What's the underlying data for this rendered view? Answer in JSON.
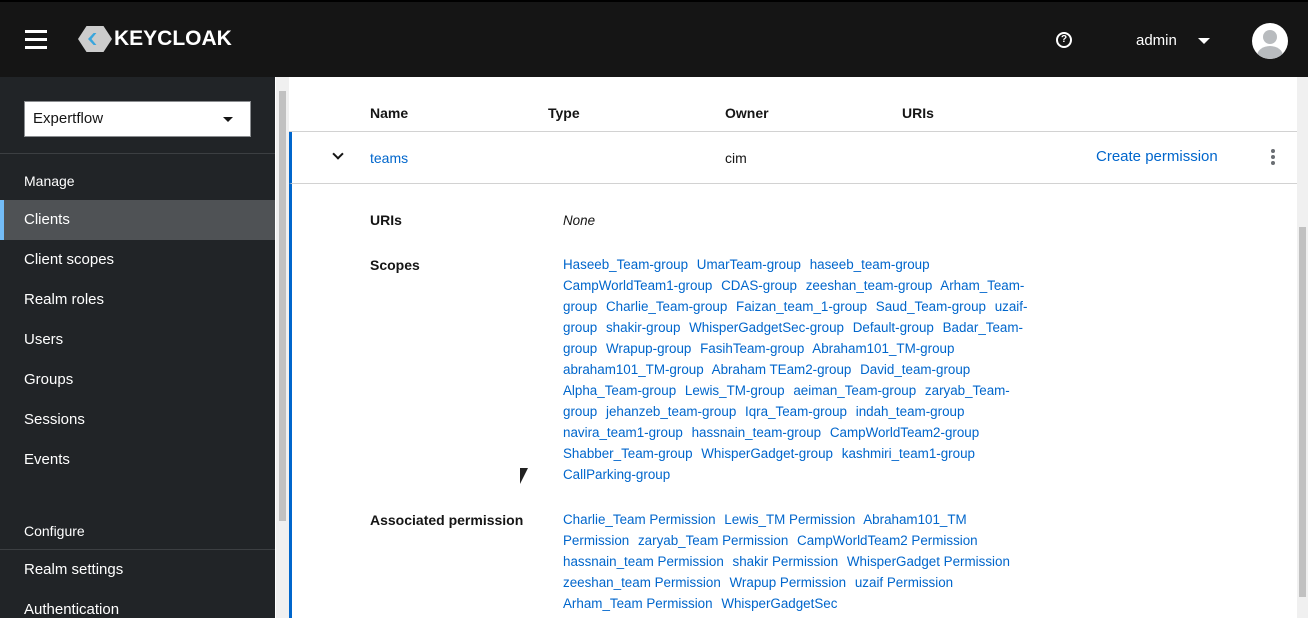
{
  "header": {
    "brand": "KEYCLOAK",
    "user": "admin"
  },
  "sidebar": {
    "realm": "Expertflow",
    "manage_label": "Manage",
    "configure_label": "Configure",
    "manage_items": [
      "Clients",
      "Client scopes",
      "Realm roles",
      "Users",
      "Groups",
      "Sessions",
      "Events"
    ],
    "configure_items": [
      "Realm settings",
      "Authentication"
    ]
  },
  "table": {
    "columns": [
      "Name",
      "Type",
      "Owner",
      "URIs"
    ],
    "row": {
      "name": "teams",
      "type": "",
      "owner": "cim",
      "action": "Create permission"
    },
    "detail": {
      "uris_label": "URIs",
      "uris_value": "None",
      "scopes_label": "Scopes",
      "perm_label": "Associated permission",
      "scopes": [
        "Haseeb_Team-group",
        "UmarTeam-group",
        "haseeb_team-group",
        "CampWorldTeam1-group",
        "CDAS-group",
        "zeeshan_team-group",
        "Arham_Team-group",
        "Charlie_Team-group",
        "Faizan_team_1-group",
        "Saud_Team-group",
        "uzaif-group",
        "shakir-group",
        "WhisperGadgetSec-group",
        "Default-group",
        "Badar_Team-group",
        "Wrapup-group",
        "FasihTeam-group",
        "Abraham101_TM-group",
        "abraham101_TM-group",
        "Abraham TEam2-group",
        "David_team-group",
        "Alpha_Team-group",
        "Lewis_TM-group",
        "aeiman_Team-group",
        "zaryab_Team-group",
        "jehanzeb_team-group",
        "Iqra_Team-group",
        "indah_team-group",
        "navira_team1-group",
        "hassnain_team-group",
        "CampWorldTeam2-group",
        "Shabber_Team-group",
        "WhisperGadget-group",
        "kashmiri_team1-group",
        "CallParking-group"
      ],
      "permissions": [
        "Charlie_Team Permission",
        "Lewis_TM Permission",
        "Abraham101_TM Permission",
        "zaryab_Team Permission",
        "CampWorldTeam2 Permission",
        "hassnain_team Permission",
        "shakir Permission",
        "WhisperGadget Permission",
        "zeeshan_team Permission",
        "Wrapup Permission",
        "uzaif Permission",
        "Arham_Team Permission",
        "WhisperGadgetSec"
      ]
    }
  }
}
